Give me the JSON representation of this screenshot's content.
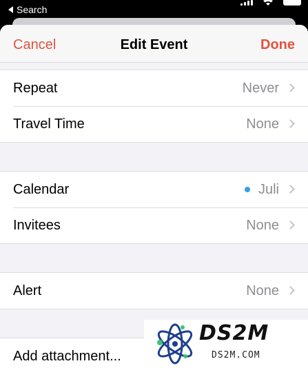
{
  "status_bar": {
    "back_label": "Search"
  },
  "nav": {
    "cancel_label": "Cancel",
    "title": "Edit Event",
    "done_label": "Done"
  },
  "groups": [
    {
      "rows": [
        {
          "label": "Repeat",
          "value": "Never"
        },
        {
          "label": "Travel Time",
          "value": "None"
        }
      ]
    },
    {
      "rows": [
        {
          "label": "Calendar",
          "value": "Juli"
        },
        {
          "label": "Invitees",
          "value": "None"
        }
      ]
    },
    {
      "rows": [
        {
          "label": "Alert",
          "value": "None"
        }
      ]
    },
    {
      "rows": [
        {
          "label": "Add attachment..."
        }
      ]
    }
  ],
  "watermark": {
    "name": "DS2M",
    "domain": "DS2M.COM"
  },
  "colors": {
    "accent": "#e0533f",
    "calendar_dot": "#3b9de0",
    "secondary_text": "#8e8e93",
    "background": "#f2f2f7"
  }
}
